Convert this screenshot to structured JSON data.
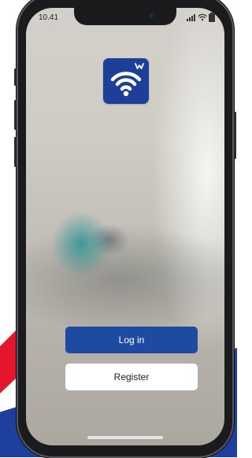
{
  "status_bar": {
    "time": "10.41"
  },
  "app": {
    "logo_icon": "wifi-logo-icon",
    "brand_color": "#1e3f97"
  },
  "buttons": {
    "login_label": "Log in",
    "register_label": "Register"
  },
  "colors": {
    "login_button": "#1f4aa1",
    "register_button": "#ffffff",
    "decor_red": "#e3162e",
    "decor_blue": "#1d3f9e"
  }
}
